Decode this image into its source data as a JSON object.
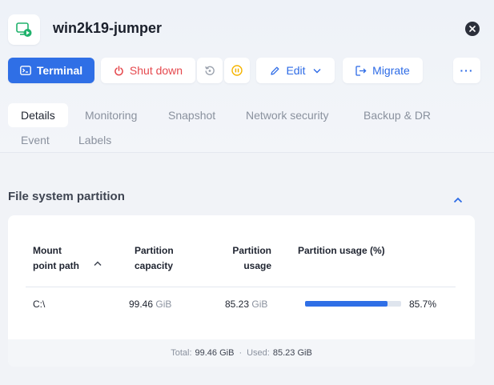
{
  "header": {
    "title": "win2k19-jumper"
  },
  "toolbar": {
    "terminal": "Terminal",
    "shutdown": "Shut down",
    "edit": "Edit",
    "migrate": "Migrate",
    "more": "···"
  },
  "tabs": [
    {
      "label": "Details",
      "active": true
    },
    {
      "label": "Monitoring"
    },
    {
      "label": "Snapshot"
    },
    {
      "label": "Network security"
    },
    {
      "label": "Backup & DR"
    },
    {
      "label": "Event"
    },
    {
      "label": "Labels"
    }
  ],
  "section": {
    "title": "File system partition"
  },
  "table": {
    "headers": {
      "mount_1": "Mount",
      "mount_2": "point path",
      "capacity_1": "Partition",
      "capacity_2": "capacity",
      "usage_1": "Partition",
      "usage_2": "usage",
      "pct": "Partition usage (%)"
    },
    "rows": [
      {
        "mount": "C:\\",
        "capacity": "99.46",
        "capacity_unit": "GiB",
        "usage": "85.23",
        "usage_unit": "GiB",
        "usage_pct_text": "85.7%",
        "usage_fraction": 0.857
      }
    ]
  },
  "footer": {
    "total_label": "Total:",
    "total_value": "99.46 GiB",
    "sep": "·",
    "used_label": "Used:",
    "used_value": "85.23 GiB"
  },
  "colors": {
    "accent": "#2f6fe6",
    "danger": "#e5484d",
    "warning": "#f5b400",
    "icon_green": "#20b26c"
  },
  "icons": {
    "vm": "vm-console-icon",
    "close": "close-icon",
    "terminal": "terminal-icon",
    "shutdown": "power-icon",
    "restart": "restart-icon",
    "pause": "pause-icon",
    "edit": "pencil-icon",
    "chevron": "chevron-down-icon",
    "migrate": "migrate-icon",
    "collapse": "chevron-up-icon"
  }
}
